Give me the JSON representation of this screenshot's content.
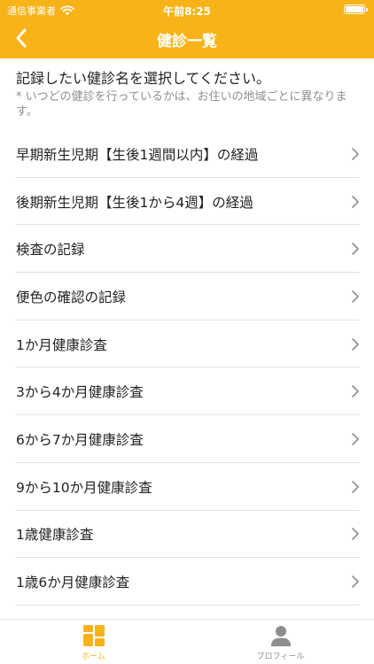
{
  "status_bar": {
    "carrier": "通信事業者",
    "time": "午前8:25"
  },
  "nav": {
    "title": "健診一覧"
  },
  "intro": {
    "main": "記録したい健診名を選択してください。",
    "note": "* いつどの健診を行っているかは、お住いの地域ごとに異なります。"
  },
  "items": [
    {
      "label": "早期新生児期【生後1週間以内】の経過"
    },
    {
      "label": "後期新生児期【生後1から4週】の経過"
    },
    {
      "label": "検査の記録"
    },
    {
      "label": "便色の確認の記録"
    },
    {
      "label": "1か月健康診査"
    },
    {
      "label": "3から4か月健康診査"
    },
    {
      "label": "6から7か月健康診査"
    },
    {
      "label": "9から10か月健康診査"
    },
    {
      "label": "1歳健康診査"
    },
    {
      "label": "1歳6か月健康診査"
    }
  ],
  "tabbar": {
    "home": "ホーム",
    "profile": "プロフィール"
  },
  "colors": {
    "accent": "#f7b318",
    "text": "#222222",
    "muted": "#8e8e8e",
    "divider": "#e2e2e2"
  }
}
